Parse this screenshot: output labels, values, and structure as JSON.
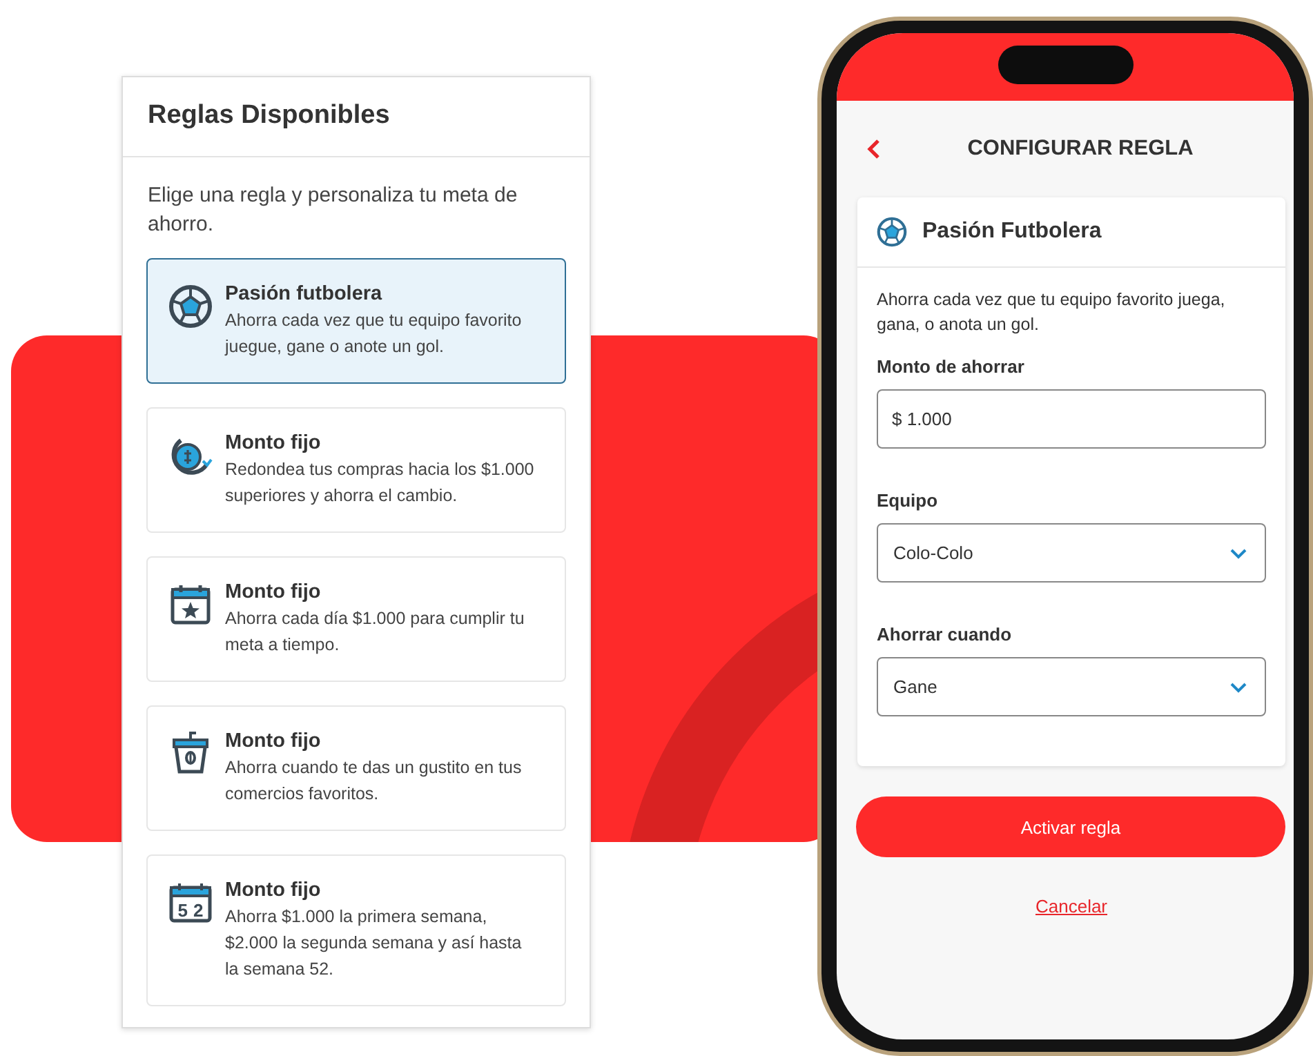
{
  "rules_panel": {
    "title": "Reglas Disponibles",
    "intro": "Elige una regla y personaliza tu meta de ahorro.",
    "rules": [
      {
        "kind": "soccer",
        "title": "Pasión futbolera",
        "description": "Ahorra cada vez que tu equipo favorito juegue, gane o anote un gol.",
        "selected": true
      },
      {
        "kind": "coin",
        "title": "Monto fijo",
        "description": "Redondea tus compras hacia los $1.000 superiores y ahorra el cambio.",
        "selected": false
      },
      {
        "kind": "calendar-star",
        "title": "Monto fijo",
        "description": "Ahorra cada día $1.000 para cumplir tu meta a tiempo.",
        "selected": false
      },
      {
        "kind": "cup",
        "title": "Monto fijo",
        "description": "Ahorra cuando te das un gustito en tus comercios favoritos.",
        "selected": false
      },
      {
        "kind": "calendar-number",
        "icon_label": "52",
        "title": "Monto fijo",
        "description": "Ahorra $1.000 la primera semana, $2.000 la segunda semana y así hasta la semana 52.",
        "selected": false
      }
    ]
  },
  "phone": {
    "title": "CONFIGURAR REGLA",
    "rule_card": {
      "title": "Pasión Futbolera",
      "description": "Ahorra cada vez que tu equipo favorito juega, gana, o anota un gol.",
      "fields": [
        {
          "kind": "text",
          "label": "Monto de ahorrar",
          "value": "$ 1.000"
        },
        {
          "kind": "select",
          "label": "Equipo",
          "value": "Colo-Colo"
        },
        {
          "kind": "select",
          "label": "Ahorrar cuando",
          "value": "Gane"
        }
      ]
    },
    "primary_button": "Activar regla",
    "cancel_link": "Cancelar"
  }
}
